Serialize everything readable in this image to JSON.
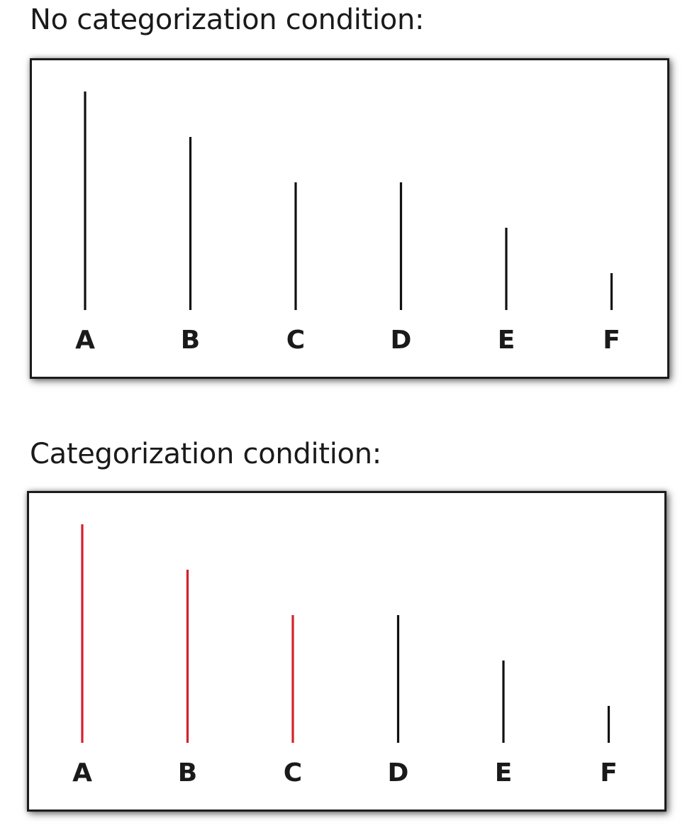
{
  "panels": [
    {
      "title": "No categorization condition:",
      "lines": [
        {
          "label": "A",
          "length": 308,
          "color": "#111111"
        },
        {
          "label": "B",
          "length": 244,
          "color": "#111111"
        },
        {
          "label": "C",
          "length": 180,
          "color": "#111111"
        },
        {
          "label": "D",
          "length": 180,
          "color": "#111111"
        },
        {
          "label": "E",
          "length": 116,
          "color": "#111111"
        },
        {
          "label": "F",
          "length": 52,
          "color": "#111111"
        }
      ]
    },
    {
      "title": "Categorization condition:",
      "lines": [
        {
          "label": "A",
          "length": 308,
          "color": "#d4202a"
        },
        {
          "label": "B",
          "length": 244,
          "color": "#d4202a"
        },
        {
          "label": "C",
          "length": 180,
          "color": "#d4202a"
        },
        {
          "label": "D",
          "length": 180,
          "color": "#111111"
        },
        {
          "label": "E",
          "length": 116,
          "color": "#111111"
        },
        {
          "label": "F",
          "length": 52,
          "color": "#111111"
        }
      ]
    }
  ]
}
